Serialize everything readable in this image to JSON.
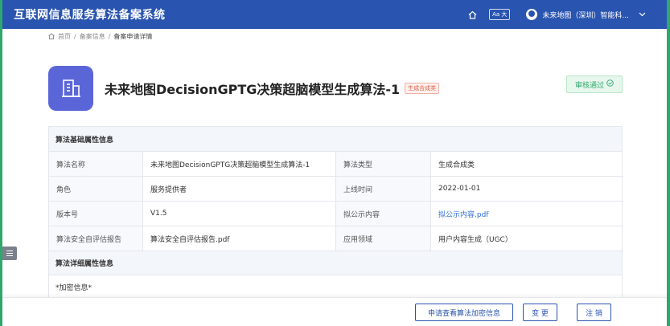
{
  "app": {
    "title": "互联网信息服务算法备案系统",
    "font_toggle_label": "Aa 大",
    "user_name": "未来地图（深圳）智能科...",
    "icons": [
      "home-icon",
      "user-avatar-icon",
      "chevron-down-icon"
    ]
  },
  "breadcrumb": {
    "home": "首页",
    "sep": "/",
    "level2": "备案信息",
    "current": "备案申请详情"
  },
  "algorithm": {
    "name": "未来地图DecisionGPTG决策超脑模型生成算法-1",
    "type_tag": "生成合成类",
    "status": "审核通过",
    "status_color": "#2fa86e",
    "icon": "building-icon",
    "icon_color": "#5a66d8"
  },
  "basic_section": {
    "title": "算法基础属性信息",
    "rows": [
      {
        "l1": "算法名称",
        "v1": "未来地图DecisionGPTG决策超脑模型生成算法-1",
        "l2": "算法类型",
        "v2": "生成合成类"
      },
      {
        "l1": "角色",
        "v1": "服务提供者",
        "l2": "上线时间",
        "v2": "2022-01-01"
      },
      {
        "l1": "版本号",
        "v1": "V1.5",
        "l2": "拟公示内容",
        "v2": "拟公示内容.pdf"
      },
      {
        "l1": "算法安全自评估报告",
        "v1": "算法安全自评估报告.pdf",
        "l2": "应用领域",
        "v2": "用户内容生成（UGC）"
      }
    ]
  },
  "detail_section": {
    "title": "算法详细属性信息",
    "encrypt_label": "*加密信息*"
  },
  "footer": {
    "request_button": "申请查看算法加密信息",
    "change_button": "变 更",
    "cancel_button": "注 销"
  },
  "colors": {
    "primary": "#2954b0",
    "link": "#2f6fd8",
    "success": "#2fa86e",
    "tag_red": "#e0604a"
  }
}
